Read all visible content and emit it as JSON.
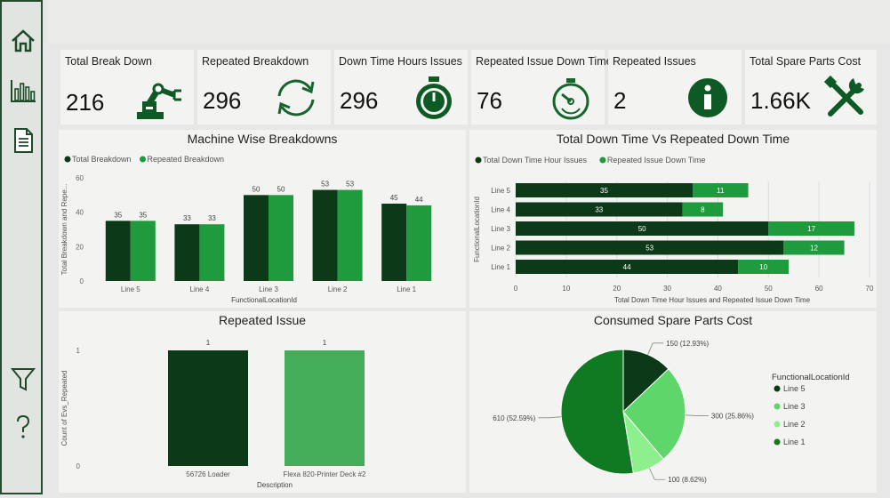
{
  "sidebar": {
    "items": [
      "home-icon",
      "bar-chart-icon",
      "document-icon"
    ],
    "bottom_items": [
      "filter-icon",
      "help-icon"
    ]
  },
  "colors": {
    "dark": "#0c3a18",
    "mid": "#1f9a3d",
    "light": "#5fd66a",
    "pale": "#8df08c",
    "accent": "#0f7a22"
  },
  "kpis": [
    {
      "title": "Total Break Down",
      "value": "216",
      "icon": "robot-arm-icon"
    },
    {
      "title": "Repeated Breakdown",
      "value": "296",
      "icon": "refresh-icon"
    },
    {
      "title": "Down Time Hours Issues",
      "value": "296",
      "icon": "stopwatch-icon"
    },
    {
      "title": "Repeated Issue Down Time",
      "value": "76",
      "icon": "timer-icon"
    },
    {
      "title": "Repeated Issues",
      "value": "2",
      "icon": "info-icon"
    },
    {
      "title": "Total Spare Parts Cost",
      "value": "1.66K",
      "icon": "tools-icon"
    }
  ],
  "chart_data": [
    {
      "type": "bar",
      "title": "Machine Wise Breakdowns",
      "xlabel": "FunctionalLocationId",
      "ylabel": "Total Breakdown and Repe...",
      "ylim": [
        0,
        60
      ],
      "yticks": [
        "0",
        "20",
        "40",
        "60"
      ],
      "legend_placement": "top-left",
      "categories": [
        "Line 5",
        "Line 4",
        "Line 3",
        "Line 2",
        "Line 1"
      ],
      "series": [
        {
          "name": "Total Breakdown",
          "values": [
            35,
            33,
            50,
            53,
            45
          ]
        },
        {
          "name": "Repeated Breakdown",
          "values": [
            35,
            33,
            50,
            53,
            44
          ]
        }
      ]
    },
    {
      "type": "bar",
      "orientation": "horizontal",
      "stacked": true,
      "title": "Total Down Time Vs Repeated Down Time",
      "xlabel": "Total Down Time Hour Issues and Repeated Issue Down Time",
      "ylabel": "FunctionalLocationId",
      "xlim": [
        0,
        70
      ],
      "xticks": [
        "0",
        "10",
        "20",
        "30",
        "40",
        "50",
        "60",
        "70"
      ],
      "legend_placement": "top-left",
      "categories": [
        "Line 5",
        "Line 4",
        "Line 3",
        "Line 2",
        "Line 1"
      ],
      "series": [
        {
          "name": "Total Down Time Hour Issues",
          "values": [
            35,
            33,
            50,
            53,
            44
          ]
        },
        {
          "name": "Repeated Issue Down Time",
          "values": [
            11,
            8,
            17,
            12,
            10
          ]
        }
      ]
    },
    {
      "type": "bar",
      "title": "Repeated Issue",
      "xlabel": "Description",
      "ylabel": "Count of Evs_Repeated",
      "ylim": [
        0,
        1
      ],
      "yticks": [
        "0",
        "1"
      ],
      "categories": [
        "56726 Loader",
        "Flexa 820-Printer Deck #2"
      ],
      "values": [
        1,
        1
      ]
    },
    {
      "type": "pie",
      "title": "Consumed Spare Parts Cost",
      "legend_title": "FunctionalLocationId",
      "legend_placement": "right",
      "slices": [
        {
          "name": "Line 5",
          "value": 150,
          "label": "150 (12.93%)"
        },
        {
          "name": "Line 3",
          "value": 300,
          "label": "300 (25.86%)"
        },
        {
          "name": "Line 2",
          "value": 100,
          "label": "100 (8.62%)"
        },
        {
          "name": "Line 1",
          "value": 610,
          "label": "610 (52.59%)"
        }
      ]
    }
  ]
}
